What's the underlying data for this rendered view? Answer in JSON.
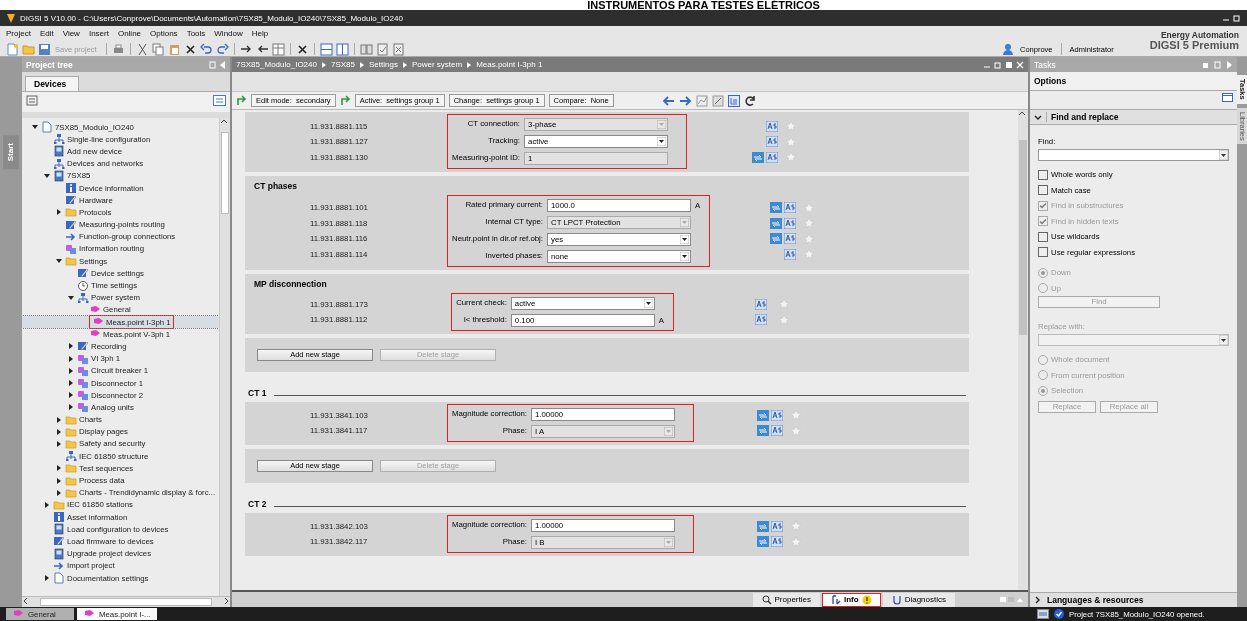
{
  "doc_heading": "INSTRUMENTOS PARA TESTES ELÉTRICOS",
  "window": {
    "title": "DIGSI 5 V10.00 - C:\\Users\\Conprove\\Documents\\Automation\\7SX85_Modulo_IO240\\7SX85_Modulo_IO240"
  },
  "menu": [
    "Project",
    "Edit",
    "View",
    "Insert",
    "Online",
    "Options",
    "Tools",
    "Window",
    "Help"
  ],
  "toolbar": {
    "save_label": "Save project",
    "user": "Conprove",
    "role": "Administrator"
  },
  "brand": {
    "line1": "Energy Automation",
    "line2": "DIGSI 5 Premium"
  },
  "side_strip": {
    "label": "Start"
  },
  "project_tree": {
    "title": "Project tree",
    "tabs": [
      {
        "label": "Devices",
        "selected": true
      }
    ],
    "items": [
      {
        "label": "7SX85_Modulo_IO240",
        "kind": "page",
        "selected": false,
        "expanded": true,
        "children": [
          {
            "label": "Single-line configuration",
            "kind": "network",
            "selected": false
          },
          {
            "label": "Add new device",
            "kind": "device",
            "selected": false
          },
          {
            "label": "Devices and networks",
            "kind": "network",
            "selected": false
          },
          {
            "label": "7SX85",
            "kind": "device",
            "selected": false,
            "expanded": true,
            "children": [
              {
                "label": "Device information",
                "kind": "info",
                "selected": false
              },
              {
                "label": "Hardware",
                "kind": "pencil",
                "selected": false
              },
              {
                "label": "Protocols",
                "kind": "folder",
                "selected": false,
                "expanded": false
              },
              {
                "label": "Measuring-points routing",
                "kind": "pencil",
                "selected": false
              },
              {
                "label": "Function-group connections",
                "kind": "arrow",
                "selected": false
              },
              {
                "label": "Information routing",
                "kind": "module",
                "selected": false
              },
              {
                "label": "Settings",
                "kind": "folder",
                "selected": false,
                "expanded": true,
                "children": [
                  {
                    "label": "Device settings",
                    "kind": "pencil",
                    "selected": false
                  },
                  {
                    "label": "Time settings",
                    "kind": "clock",
                    "selected": false
                  },
                  {
                    "label": "Power system",
                    "kind": "network",
                    "selected": false,
                    "expanded": true,
                    "children": [
                      {
                        "label": "General",
                        "kind": "flag",
                        "selected": false
                      },
                      {
                        "label": "Meas.point I-3ph 1",
                        "kind": "flag",
                        "selected": true,
                        "highlighted": true
                      },
                      {
                        "label": "Meas.point V-3ph 1",
                        "kind": "flag",
                        "selected": false
                      }
                    ]
                  },
                  {
                    "label": "Recording",
                    "kind": "pencil",
                    "selected": false,
                    "expanded": false
                  },
                  {
                    "label": "VI 3ph 1",
                    "kind": "module",
                    "selected": false,
                    "expanded": false
                  },
                  {
                    "label": "Circuit breaker 1",
                    "kind": "module",
                    "selected": false,
                    "expanded": false
                  },
                  {
                    "label": "Disconnector 1",
                    "kind": "module",
                    "selected": false,
                    "expanded": false
                  },
                  {
                    "label": "Disconnector 2",
                    "kind": "module",
                    "selected": false,
                    "expanded": false
                  },
                  {
                    "label": "Analog units",
                    "kind": "module",
                    "selected": false,
                    "expanded": false
                  }
                ]
              },
              {
                "label": "Charts",
                "kind": "folder",
                "selected": false,
                "expanded": false
              },
              {
                "label": "Display pages",
                "kind": "folder",
                "selected": false,
                "expanded": false
              },
              {
                "label": "Safety and security",
                "kind": "folder",
                "selected": false,
                "expanded": false
              },
              {
                "label": "IEC 61850 structure",
                "kind": "network",
                "selected": false
              },
              {
                "label": "Test sequences",
                "kind": "folder",
                "selected": false,
                "expanded": false
              },
              {
                "label": "Process data",
                "kind": "folder",
                "selected": false,
                "expanded": false
              },
              {
                "label": "Charts - Trendidynamic display & forc...",
                "kind": "folder",
                "selected": false,
                "expanded": false
              }
            ]
          },
          {
            "label": "IEC 61850 stations",
            "kind": "folder",
            "selected": false,
            "expanded": false
          },
          {
            "label": "Asset information",
            "kind": "info",
            "selected": false
          },
          {
            "label": "Load configuration to devices",
            "kind": "device",
            "selected": false
          },
          {
            "label": "Load firmware to devices",
            "kind": "pencil",
            "selected": false
          },
          {
            "label": "Upgrade project devices",
            "kind": "device",
            "selected": false
          },
          {
            "label": "Import project",
            "kind": "arrow",
            "selected": false
          },
          {
            "label": "Documentation settings",
            "kind": "page",
            "selected": false,
            "expanded": false
          }
        ]
      }
    ]
  },
  "editor": {
    "breadcrumb": [
      "7SX85_Modulo_IO240",
      "7SX85",
      "Settings",
      "Power system",
      "Meas.point I-3ph 1"
    ],
    "status_fields": [
      "Edit mode:  secondary",
      "Active:  settings group 1",
      "Change:  settings group 1",
      "Compare:  None"
    ],
    "blocks": [
      {
        "kind": "params",
        "highlighted": true,
        "rows": [
          {
            "id": "11.931.8881.115",
            "label": "CT connection:",
            "value": "3-phase",
            "kind": "dropdown",
            "disabled": true,
            "sync": false
          },
          {
            "id": "11.931.8881.127",
            "label": "Tracking:",
            "value": "active",
            "kind": "dropdown",
            "disabled": false,
            "sync": false
          },
          {
            "id": "11.931.8881.130",
            "label": "Measuring-point ID:",
            "value": "1",
            "kind": "text",
            "disabled": true,
            "sync": true
          }
        ]
      },
      {
        "kind": "params",
        "title": "CT phases",
        "highlighted": true,
        "rows": [
          {
            "id": "11.931.8881.101",
            "label": "Rated primary current:",
            "value": "1000.0",
            "kind": "text",
            "disabled": false,
            "sync": true,
            "unit": "A"
          },
          {
            "id": "11.931.8881.118",
            "label": "Internal CT type:",
            "value": "CT LPCT Protection",
            "kind": "dropdown",
            "disabled": true,
            "sync": true
          },
          {
            "id": "11.931.8881.116",
            "label": "Neutr.point in dir.of ref.obj:",
            "value": "yes",
            "kind": "dropdown",
            "disabled": false,
            "sync": true
          },
          {
            "id": "11.931.8881.114",
            "label": "Inverted phases:",
            "value": "none",
            "kind": "dropdown",
            "disabled": false,
            "sync": false
          }
        ]
      },
      {
        "kind": "params",
        "title": "MP disconnection",
        "highlighted": true,
        "rows": [
          {
            "id": "11.931.8881.173",
            "label": "Current check:",
            "value": "active",
            "kind": "dropdown",
            "disabled": false,
            "sync": false
          },
          {
            "id": "11.931.8881.112",
            "label": "I< threshold:",
            "value": "0.100",
            "kind": "text",
            "disabled": false,
            "sync": false,
            "unit": "A"
          }
        ]
      },
      {
        "kind": "stage-buttons",
        "buttons": [
          {
            "label": "Add new stage",
            "disabled": false
          },
          {
            "label": "Delete stage",
            "disabled": true
          }
        ]
      },
      {
        "kind": "heading",
        "title": "CT 1"
      },
      {
        "kind": "params",
        "highlighted": true,
        "rows": [
          {
            "id": "11.931.3841.103",
            "label": "Magnitude correction:",
            "value": "1.00000",
            "kind": "text",
            "disabled": false,
            "sync": true
          },
          {
            "id": "11.931.3841.117",
            "label": "Phase:",
            "value": "I A",
            "kind": "dropdown",
            "disabled": true,
            "sync": true
          }
        ]
      },
      {
        "kind": "stage-buttons",
        "buttons": [
          {
            "label": "Add new stage",
            "disabled": false
          },
          {
            "label": "Delete stage",
            "disabled": true
          }
        ]
      },
      {
        "kind": "heading",
        "title": "CT 2"
      },
      {
        "kind": "params",
        "highlighted": true,
        "rows": [
          {
            "id": "11.931.3842.103",
            "label": "Magnitude correction:",
            "value": "1.00000",
            "kind": "text",
            "disabled": false,
            "sync": true
          },
          {
            "id": "11.931.3842.117",
            "label": "Phase:",
            "value": "I B",
            "kind": "dropdown",
            "disabled": true,
            "sync": true
          }
        ]
      }
    ]
  },
  "inspector_tabs": [
    {
      "label": "Properties",
      "selected": false,
      "highlighted": false,
      "warning": false
    },
    {
      "label": "Info",
      "selected": true,
      "highlighted": true,
      "warning": true
    },
    {
      "label": "Diagnostics",
      "selected": false,
      "highlighted": false,
      "warning": false
    }
  ],
  "tasks": {
    "title": "Tasks",
    "section": "Options",
    "group": {
      "title": "Find and replace",
      "expanded": true
    },
    "find_label": "Find:",
    "options": [
      {
        "label": "Whole words only",
        "checked": false,
        "disabled": false
      },
      {
        "label": "Match case",
        "checked": false,
        "disabled": false
      },
      {
        "label": "Find in substructures",
        "checked": true,
        "disabled": true
      },
      {
        "label": "Find in hidden texts",
        "checked": true,
        "disabled": true
      },
      {
        "label": "Use wildcards",
        "checked": false,
        "disabled": false
      },
      {
        "label": "Use regular expressions",
        "checked": false,
        "disabled": false
      }
    ],
    "direction": [
      {
        "label": "Down",
        "selected": true,
        "disabled": true
      },
      {
        "label": "Up",
        "selected": false,
        "disabled": true
      }
    ],
    "find_button": {
      "label": "Find",
      "disabled": true
    },
    "replace_label": {
      "text": "Replace with:",
      "disabled": true
    },
    "scope": [
      {
        "label": "Whole document",
        "selected": false,
        "disabled": true
      },
      {
        "label": "From current position",
        "selected": false,
        "disabled": true
      },
      {
        "label": "Selection",
        "selected": true,
        "disabled": true
      }
    ],
    "replace_buttons": [
      {
        "label": "Replace",
        "disabled": true
      },
      {
        "label": "Replace all",
        "disabled": true
      }
    ],
    "footer": "Languages & resources"
  },
  "side_tabs": [
    {
      "label": "Tasks",
      "selected": true
    },
    {
      "label": "Libraries",
      "selected": false
    }
  ],
  "open_tabs": [
    {
      "label": "General",
      "selected": false
    },
    {
      "label": "Meas.point I-...",
      "selected": true
    }
  ],
  "status": "Project 7SX85_Modulo_IO240 opened."
}
